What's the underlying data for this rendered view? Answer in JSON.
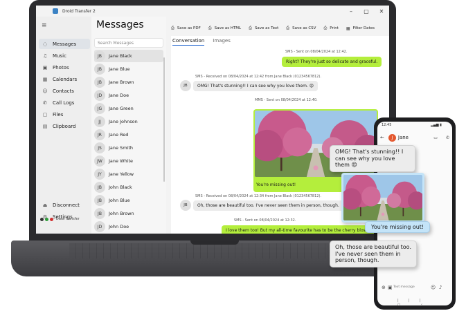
{
  "window": {
    "title": "Droid Transfer 2"
  },
  "nav": {
    "items": [
      {
        "label": "Messages",
        "icon": "message-icon",
        "glyph": "◌"
      },
      {
        "label": "Music",
        "icon": "music-icon",
        "glyph": "♫"
      },
      {
        "label": "Photos",
        "icon": "photo-icon",
        "glyph": "▣"
      },
      {
        "label": "Calendars",
        "icon": "calendar-icon",
        "glyph": "▦"
      },
      {
        "label": "Contacts",
        "icon": "contacts-icon",
        "glyph": "☺"
      },
      {
        "label": "Call Logs",
        "icon": "phone-icon",
        "glyph": "✆"
      },
      {
        "label": "Files",
        "icon": "file-icon",
        "glyph": "▢"
      },
      {
        "label": "Clipboard",
        "icon": "clipboard-icon",
        "glyph": "▤"
      }
    ],
    "bottom": [
      {
        "label": "Disconnect",
        "icon": "disconnect-icon",
        "glyph": "⏏"
      },
      {
        "label": "Settings",
        "icon": "gear-icon",
        "glyph": "⚙"
      }
    ],
    "device_label": "Data Transfer"
  },
  "contacts": {
    "title": "Messages",
    "search_placeholder": "Search Messages",
    "list": [
      {
        "initials": "JB",
        "name": "Jane Black"
      },
      {
        "initials": "JB",
        "name": "Jane Blue"
      },
      {
        "initials": "JB",
        "name": "Jane Brown"
      },
      {
        "initials": "JD",
        "name": "Jane Doe"
      },
      {
        "initials": "JG",
        "name": "Jane Green"
      },
      {
        "initials": "JJ",
        "name": "Jane Johnson"
      },
      {
        "initials": "JR",
        "name": "Jane Red"
      },
      {
        "initials": "JS",
        "name": "Jane Smith"
      },
      {
        "initials": "JW",
        "name": "Jane White"
      },
      {
        "initials": "JY",
        "name": "Jane Yellow"
      },
      {
        "initials": "JB",
        "name": "John Black"
      },
      {
        "initials": "JB",
        "name": "John Blue"
      },
      {
        "initials": "JB",
        "name": "John Brown"
      },
      {
        "initials": "JD",
        "name": "John Doe"
      }
    ]
  },
  "toolbar": [
    {
      "label": "Save as PDF",
      "icon": "pdf-icon",
      "glyph": "⎙"
    },
    {
      "label": "Save as HTML",
      "icon": "html-icon",
      "glyph": "⎙"
    },
    {
      "label": "Save as Text",
      "icon": "text-icon",
      "glyph": "⎙"
    },
    {
      "label": "Save as CSV",
      "icon": "csv-icon",
      "glyph": "⎙"
    },
    {
      "label": "Print",
      "icon": "print-icon",
      "glyph": "⎙"
    },
    {
      "label": "Filter Dates",
      "icon": "filter-icon",
      "glyph": "▦"
    }
  ],
  "tabs": [
    {
      "label": "Conversation"
    },
    {
      "label": "Images"
    }
  ],
  "conversation": {
    "m1_meta": "SMS - Sent on 08/04/2024 at 12:42.",
    "m1_text": "Right? They're just so delicate and graceful.",
    "m2_meta": "SMS - Received on 08/04/2024 at 12:42 from Jane Black (01234567812).",
    "m2_text": "OMG! That's stunning!! I can see why you love them. 😍",
    "m2_avatar": "JB",
    "m3_meta": "MMS - Sent on 08/04/2024 at 12:40.",
    "m3_text": "You're missing out!",
    "m4_meta": "SMS - Received on 08/04/2024 at 12:34 from Jane Black (01234567812).",
    "m4_text": "Oh, those are beautiful too. I've never seen them in person, though.",
    "m4_avatar": "JB",
    "m5_meta": "SMS - Sent on 08/04/2024 at 12:32.",
    "m5_text": "I love them too! But my all-time favourite has to be the cherry blossoms"
  },
  "phone": {
    "time": "12:45",
    "status_right": "▂▄▆ ▮",
    "contact_initial": "J",
    "contact_name": "Jane",
    "input_placeholder": "Text message",
    "callout1": "OMG! That's stunning!! I can see why you love them 😍",
    "callout2": "You're missing out!",
    "callout3": "Oh, those are beautiful too. I've never seen them in person, though."
  },
  "colors": {
    "sent_bubble": "#b4ee3c",
    "received_bubble": "#ebebeb",
    "phone_sent_bubble": "#c4e4f8",
    "accent": "#2a6bd1"
  }
}
